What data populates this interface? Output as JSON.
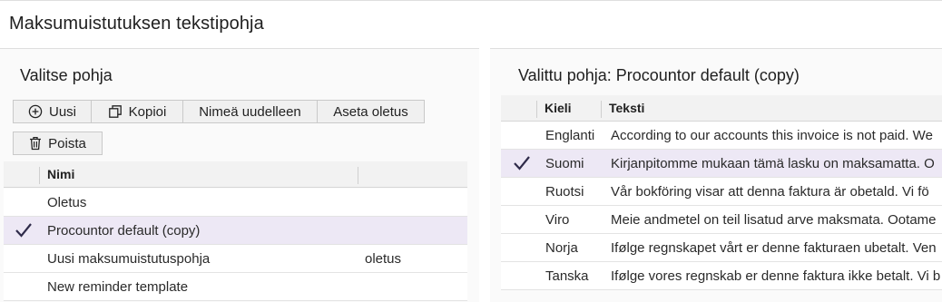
{
  "page": {
    "title": "Maksumuistutuksen tekstipohja"
  },
  "left": {
    "title": "Valitse pohja",
    "buttons": {
      "new": "Uusi",
      "copy": "Kopioi",
      "rename": "Nimeä uudelleen",
      "set_default": "Aseta oletus",
      "delete": "Poista"
    },
    "table": {
      "col_name": "Nimi",
      "rows": [
        {
          "name": "Oletus",
          "note": "",
          "selected": false
        },
        {
          "name": "Procountor default (copy)",
          "note": "",
          "selected": true
        },
        {
          "name": "Uusi maksumuistutuspohja",
          "note": "oletus",
          "selected": false
        },
        {
          "name": "New reminder template",
          "note": "",
          "selected": false
        }
      ]
    }
  },
  "right": {
    "title": "Valittu pohja: Procountor default (copy)",
    "table": {
      "col_language": "Kieli",
      "col_text": "Teksti",
      "rows": [
        {
          "language": "Englanti",
          "text": "According to our accounts this invoice is not paid. We",
          "selected": false
        },
        {
          "language": "Suomi",
          "text": "Kirjanpitomme mukaan tämä lasku on maksamatta. O",
          "selected": true
        },
        {
          "language": "Ruotsi",
          "text": "Vår bokföring visar att denna faktura är obetald. Vi fö",
          "selected": false
        },
        {
          "language": "Viro",
          "text": "Meie andmetel on teil lisatud arve maksmata. Ootame",
          "selected": false
        },
        {
          "language": "Norja",
          "text": "Ifølge regnskapet vårt er denne fakturaen ubetalt. Ven",
          "selected": false
        },
        {
          "language": "Tanska",
          "text": "Ifølge vores regnskab er denne faktura ikke betalt. Vi b",
          "selected": false
        }
      ]
    }
  },
  "colors": {
    "selected_row": "#ede8f5",
    "check": "#2f2b4a"
  }
}
